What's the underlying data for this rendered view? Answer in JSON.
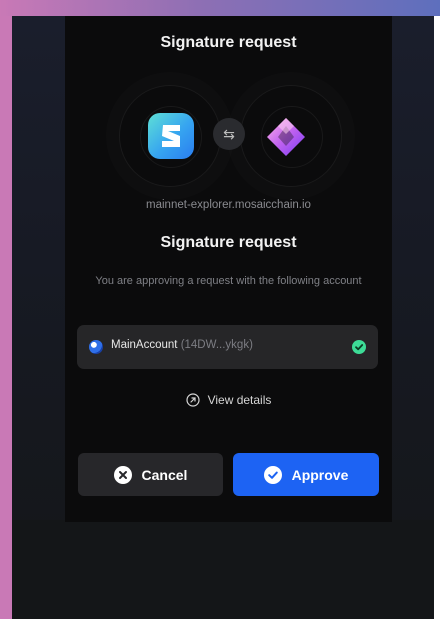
{
  "dialog": {
    "title": "Signature request",
    "domain": "mainnet-explorer.mosaicchain.io",
    "heading": "Signature request",
    "description": "You are approving a request with the following account"
  },
  "account": {
    "name": "MainAccount",
    "address": "(14DW...ykgk)",
    "selected": true
  },
  "links": {
    "view_details": "View details"
  },
  "buttons": {
    "cancel": "Cancel",
    "approve": "Approve"
  },
  "icons": {
    "dapp_logo": "mosaic-logo-icon",
    "wallet_logo": "subwallet-logo-icon",
    "swap": "swap-arrows-icon",
    "view_details": "arrow-up-right-icon",
    "cancel": "close-circle-icon",
    "approve": "check-circle-icon"
  },
  "colors": {
    "accent": "#1d63f3",
    "success": "#3ddc97",
    "panel": "#0b0b0c"
  }
}
